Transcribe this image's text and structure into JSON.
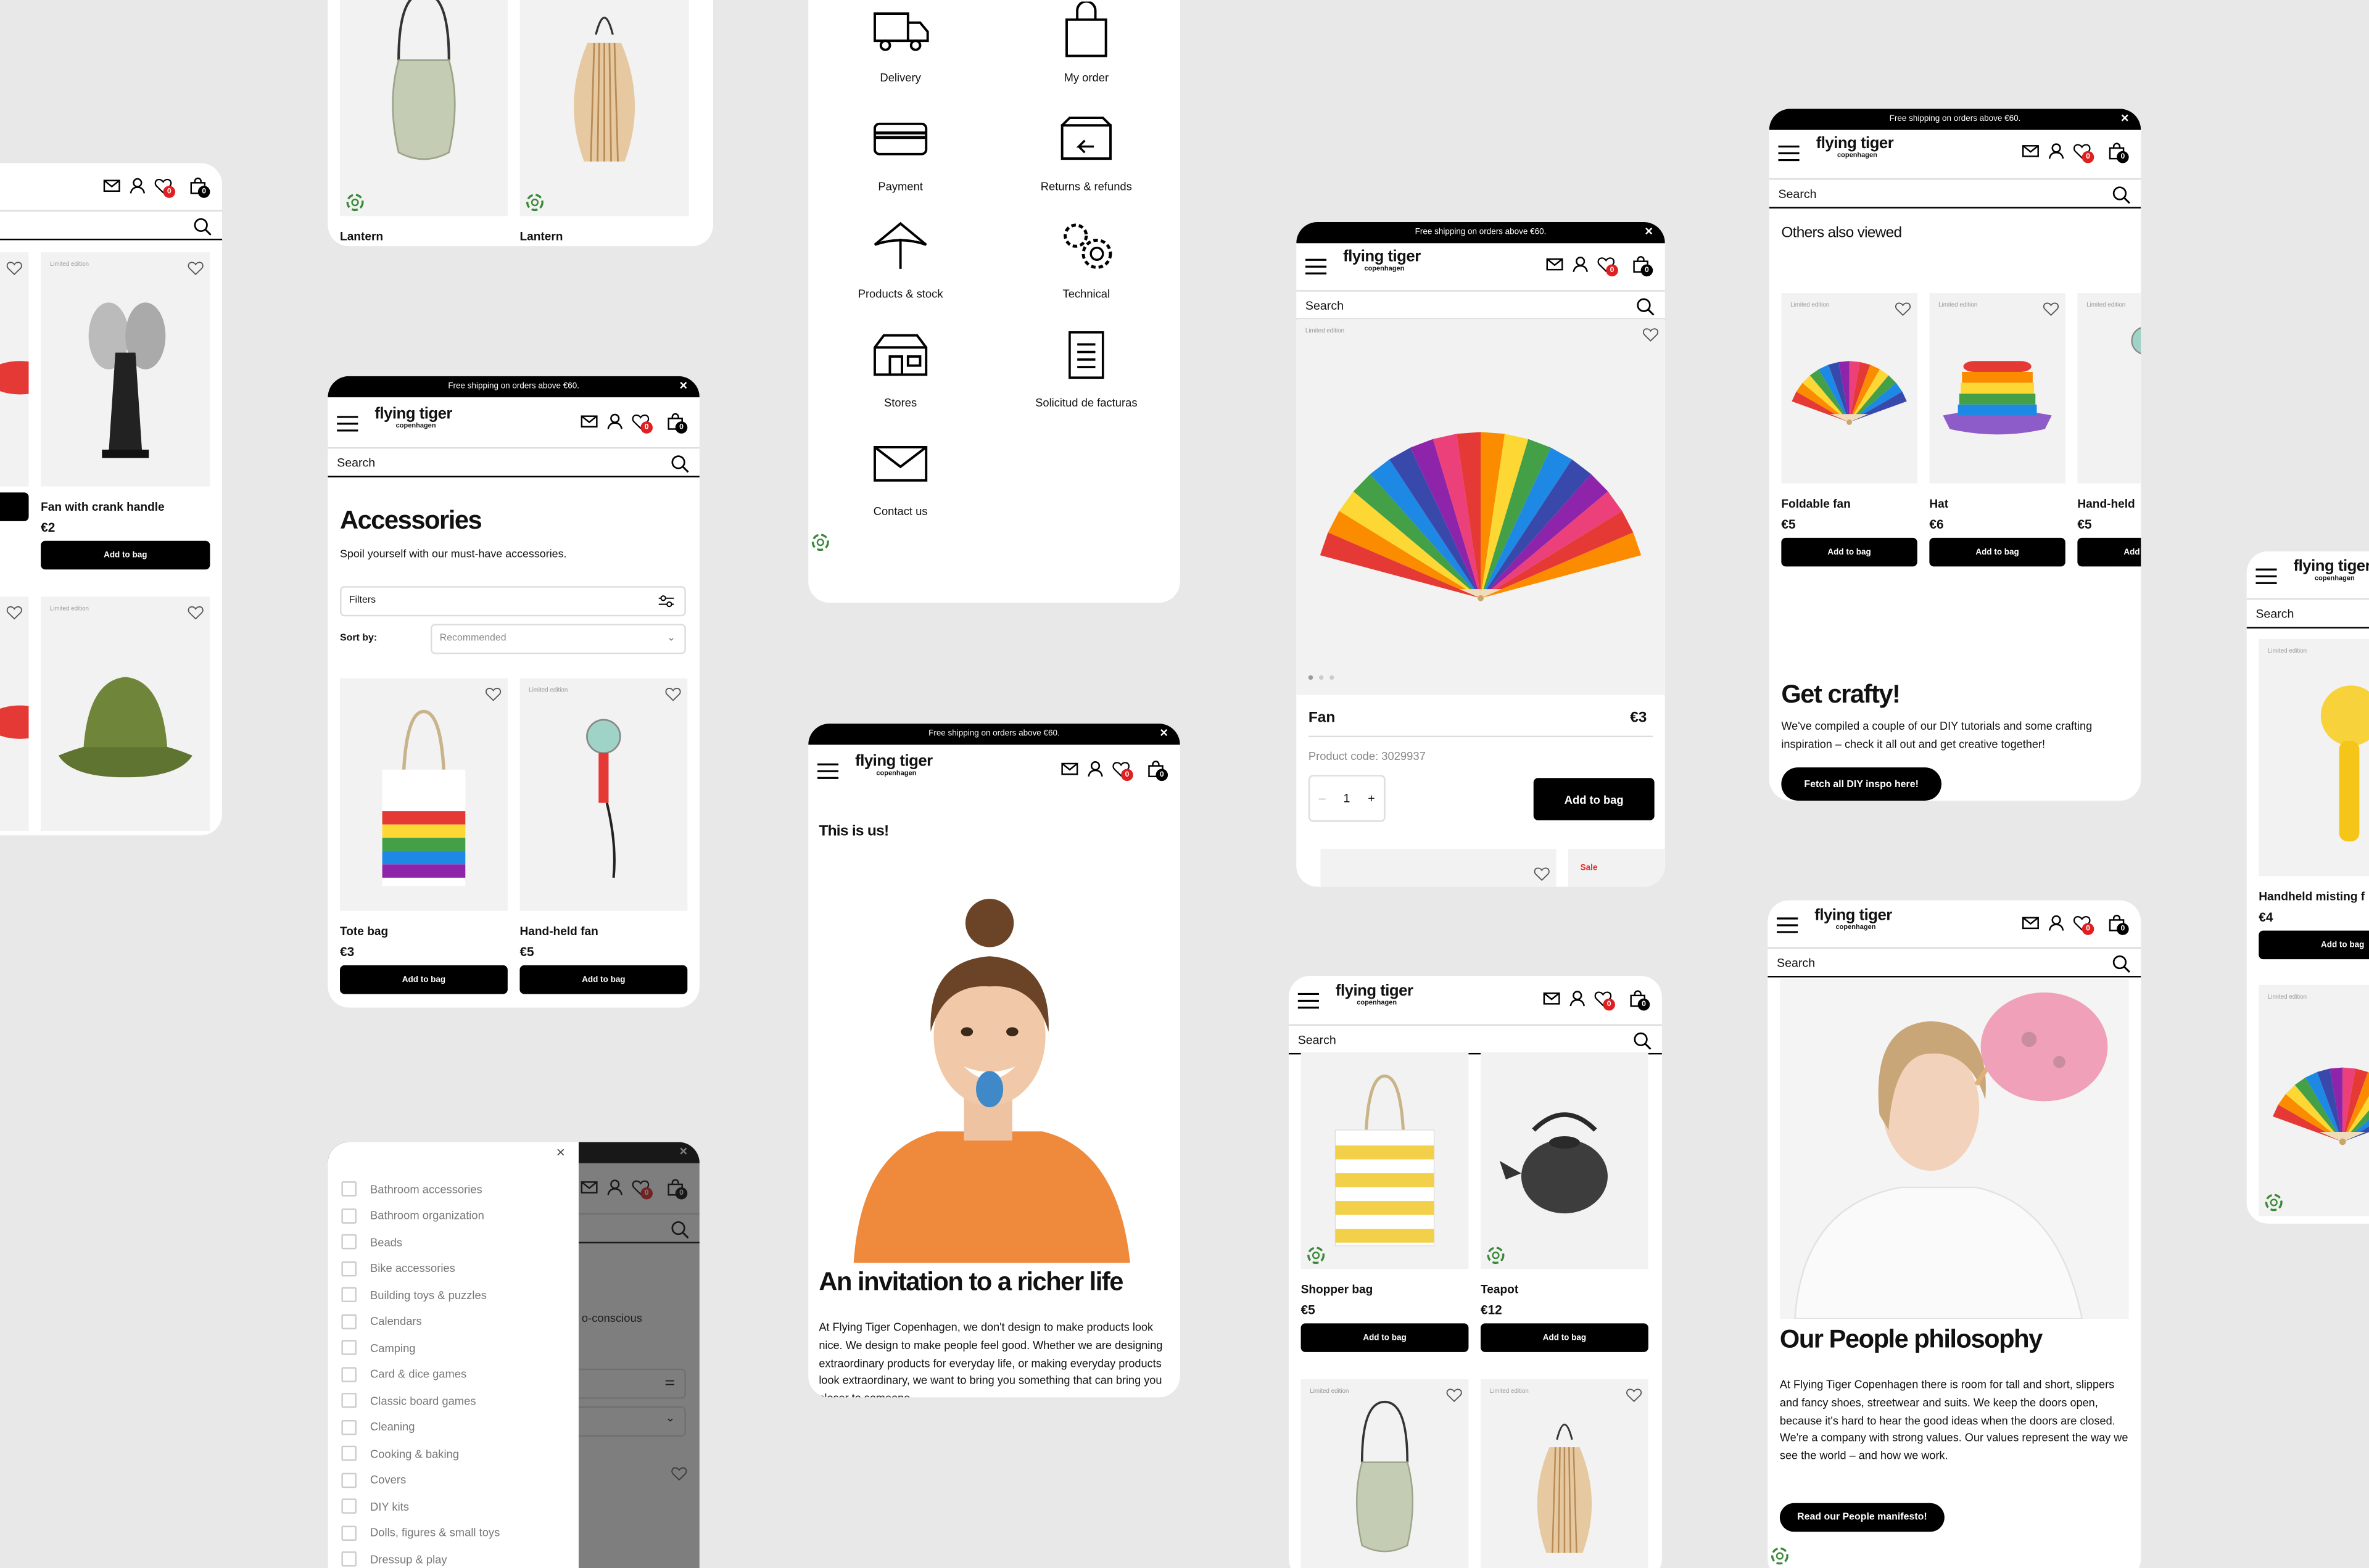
{
  "common": {
    "promo": "Free shipping on orders above €60.",
    "logo": "flying tiger",
    "logo_sub": "copenhagen",
    "search_placeholder": "Search",
    "wishlist_count": "0",
    "bag_count": "0",
    "add_to_bag": "Add to bag",
    "limited": "Limited edition"
  },
  "colors": {
    "accent": "#000000",
    "badge_red": "#e02020",
    "sale_red": "#e03030",
    "page_bg": "#e8e8e8",
    "image_bg": "#f2f2f2"
  },
  "icons": [
    "hamburger-icon",
    "mail-icon",
    "user-icon",
    "heart-icon",
    "bag-icon",
    "search-icon",
    "close-icon",
    "filter-sliders-icon",
    "chevron-down-icon"
  ],
  "left_partial": {
    "products": [
      {
        "image": "red-item",
        "heart": true
      },
      {
        "name": "Fan with crank handle",
        "price": "€2",
        "image": "desk-fan",
        "limited": true
      },
      {
        "image": "red-item",
        "heart": true
      },
      {
        "image": "green-bucket-hat",
        "limited": true
      }
    ]
  },
  "lantern_top": {
    "products": [
      {
        "name": "Lantern",
        "image": "glass-lantern"
      },
      {
        "name": "Lantern",
        "image": "bamboo-lantern"
      }
    ]
  },
  "accessories": {
    "title": "Accessories",
    "subtitle": "Spoil yourself with our must-have accessories.",
    "filters_label": "Filters",
    "sort_label": "Sort by:",
    "sort_value": "Recommended",
    "products": [
      {
        "name": "Tote bag",
        "price": "€3",
        "image": "rainbow-tote-bag"
      },
      {
        "name": "Hand-held fan",
        "price": "€5",
        "image": "hand-held-fan",
        "limited": true
      }
    ]
  },
  "filter_panel": {
    "underlay_text": "o-conscious",
    "items": [
      "Bathroom accessories",
      "Bathroom organization",
      "Beads",
      "Bike accessories",
      "Building toys & puzzles",
      "Calendars",
      "Camping",
      "Card & dice games",
      "Classic board games",
      "Cleaning",
      "Cooking & baking",
      "Covers",
      "DIY kits",
      "Dolls, figures & small toys",
      "Dressup & play"
    ]
  },
  "help": {
    "items": [
      {
        "label": "Delivery",
        "icon": "truck-icon"
      },
      {
        "label": "My order",
        "icon": "shopping-bag-icon"
      },
      {
        "label": "Payment",
        "icon": "credit-card-icon"
      },
      {
        "label": "Returns & refunds",
        "icon": "return-box-icon"
      },
      {
        "label": "Products & stock",
        "icon": "umbrella-icon"
      },
      {
        "label": "Technical",
        "icon": "gears-icon"
      },
      {
        "label": "Stores",
        "icon": "store-icon"
      },
      {
        "label": "Solicitud de facturas",
        "icon": "document-icon"
      },
      {
        "label": "Contact us",
        "icon": "envelope-icon"
      }
    ]
  },
  "about": {
    "heading": "This is us!",
    "title": "An invitation to a richer life",
    "body": "At Flying Tiger Copenhagen, we don't design to make products look nice. We design to make people feel good. Whether we are designing extraordinary products for everyday life, or making everyday products look extraordinary, we want to bring you something that can bring you closer to someone"
  },
  "product_detail": {
    "name": "Fan",
    "price": "€3",
    "product_code": "Product code: 3029937",
    "quantity": "1",
    "minus": "–",
    "plus": "+",
    "add_to_bag": "Add to bag",
    "sale_label": "Sale",
    "gallery_pages": 3,
    "gallery_active": 1
  },
  "shopper": {
    "products": [
      {
        "name": "Shopper bag",
        "price": "€5",
        "image": "yellow-striped-tote"
      },
      {
        "name": "Teapot",
        "price": "€12",
        "image": "cast-iron-teapot"
      },
      {
        "image": "glass-lantern",
        "limited": true
      },
      {
        "image": "bamboo-lantern",
        "limited": true
      }
    ]
  },
  "others": {
    "heading": "Others also viewed",
    "products": [
      {
        "name": "Foldable fan",
        "price": "€5",
        "image": "rainbow-fan",
        "limited": true
      },
      {
        "name": "Hat",
        "price": "€6",
        "image": "rainbow-bucket-hat",
        "limited": true
      },
      {
        "name": "Hand-held",
        "price": "€5",
        "image": "hand-held-fan",
        "limited": true
      }
    ],
    "title": "Get crafty!",
    "body": "We've compiled a couple of our DIY tutorials and some crafting inspiration – check it all out and get creative together!",
    "cta": "Fetch all DIY inspo here!"
  },
  "people": {
    "title": "Our People philosophy",
    "body": "At Flying Tiger Copenhagen there is room for tall and short, slippers and fancy shoes, streetwear and suits. We keep the doors open, because it's hard to hear the good ideas when the doors are closed. We're a company with strong values. Our values represent the way we see the world – and how we work.",
    "cta": "Read our People manifesto!"
  },
  "right_partial": {
    "products": [
      {
        "name": "Handheld misting f",
        "price": "€4",
        "image": "yellow-misting-fan",
        "limited": true
      },
      {
        "image": "rainbow-fan",
        "limited": true
      }
    ]
  }
}
